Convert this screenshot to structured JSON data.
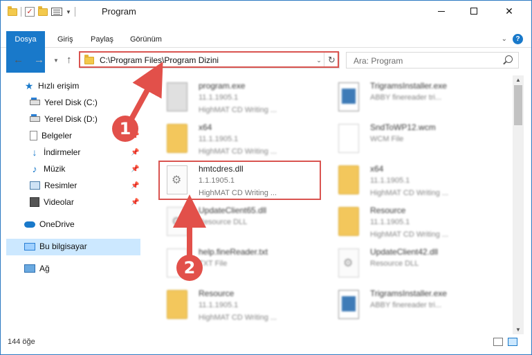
{
  "window": {
    "title": "Program"
  },
  "ribbon": {
    "tabs": [
      "Dosya",
      "Giriş",
      "Paylaş",
      "Görünüm"
    ]
  },
  "nav": {
    "address": "C:\\Program Files\\Program Dizini",
    "search_placeholder": "Ara: Program"
  },
  "sidebar": {
    "items": [
      {
        "label": "Hızlı erişim",
        "icon": "star-icon"
      },
      {
        "label": "Yerel Disk (C:)",
        "icon": "drive-icon"
      },
      {
        "label": "Yerel Disk (D:)",
        "icon": "drive-icon"
      },
      {
        "label": "Belgeler",
        "icon": "documents-icon"
      },
      {
        "label": "İndirmeler",
        "icon": "download-icon"
      },
      {
        "label": "Müzik",
        "icon": "music-icon"
      },
      {
        "label": "Resimler",
        "icon": "pictures-icon"
      },
      {
        "label": "Videolar",
        "icon": "videos-icon"
      },
      {
        "label": "OneDrive",
        "icon": "cloud-icon"
      },
      {
        "label": "Bu bilgisayar",
        "icon": "computer-icon"
      },
      {
        "label": "Ağ",
        "icon": "network-icon"
      }
    ]
  },
  "files": [
    {
      "name": "program.exe",
      "line2": "11.1.1905.1",
      "line3": "HighMAT CD Writing ...",
      "icon": "exe"
    },
    {
      "name": "TrigramsInstaller.exe",
      "line2": "ABBY finereader tri...",
      "line3": "",
      "icon": "exe"
    },
    {
      "name": "x64",
      "line2": "11.1.1905.1",
      "line3": "HighMAT CD Writing ...",
      "icon": "folder"
    },
    {
      "name": "SndToWP12.wcm",
      "line2": "WCM File",
      "line3": "",
      "icon": "doc"
    },
    {
      "name": "hmtcdres.dll",
      "line2": "1.1.1905.1",
      "line3": "HighMAT CD Writing ...",
      "icon": "dll"
    },
    {
      "name": "x64",
      "line2": "11.1.1905.1",
      "line3": "HighMAT CD Writing ...",
      "icon": "folder"
    },
    {
      "name": "UpdateClient65.dll",
      "line2": "Resource DLL",
      "line3": "",
      "icon": "dll"
    },
    {
      "name": "Resource",
      "line2": "11.1.1905.1",
      "line3": "HighMAT CD Writing ...",
      "icon": "folder"
    },
    {
      "name": "help.fineReader.txt",
      "line2": "TXT File",
      "line3": "",
      "icon": "doc"
    },
    {
      "name": "UpdateClient42.dll",
      "line2": "Resource DLL",
      "line3": "",
      "icon": "dll"
    },
    {
      "name": "Resource",
      "line2": "11.1.1905.1",
      "line3": "HighMAT CD Writing ...",
      "icon": "folder"
    },
    {
      "name": "TrigramsInstaller.exe",
      "line2": "ABBY finereader tri...",
      "line3": "",
      "icon": "exe"
    }
  ],
  "status": {
    "count": "144 öğe"
  },
  "annotations": {
    "step1": "1",
    "step2": "2",
    "color": "#e2504a"
  }
}
